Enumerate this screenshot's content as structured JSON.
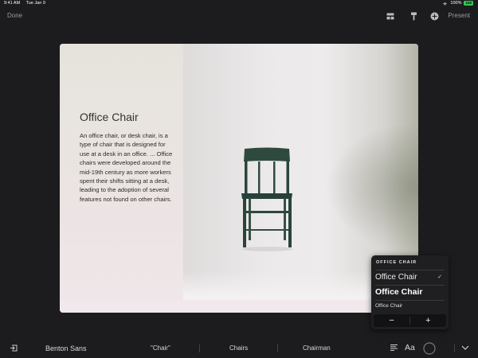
{
  "status_bar": {
    "time": "9:41 AM",
    "date": "Tue Jan 9",
    "battery_pct": "100%",
    "battery_badge": "100"
  },
  "toolbar": {
    "done_label": "Done",
    "present_label": "Present",
    "icons": [
      "slide-layout-icon",
      "format-brush-icon",
      "add-icon"
    ]
  },
  "slide": {
    "title": "Office Chair",
    "body": "An office chair, or desk chair, is a type of chair that is designed for use at a desk in an office. ... Office chairs were developed around the mid-19th century as more workers spent their shifts sitting at a desk, leading to the adoption of several features not found on other chairs."
  },
  "font_popover": {
    "header": "OFFICE CHAIR",
    "option_regular": "Office Chair",
    "option_bold": "Office Chair",
    "option_small": "Office Chair",
    "selected_index": 0,
    "minus_label": "−",
    "plus_label": "+"
  },
  "bottom_bar": {
    "font_name": "Benton Sans",
    "suggestions": [
      "\"Chair\"",
      "Chairs",
      "Chairman"
    ],
    "text_style_label": "Aa"
  },
  "colors": {
    "accent_green": "#34c759",
    "chair": "#2e4a3e"
  }
}
